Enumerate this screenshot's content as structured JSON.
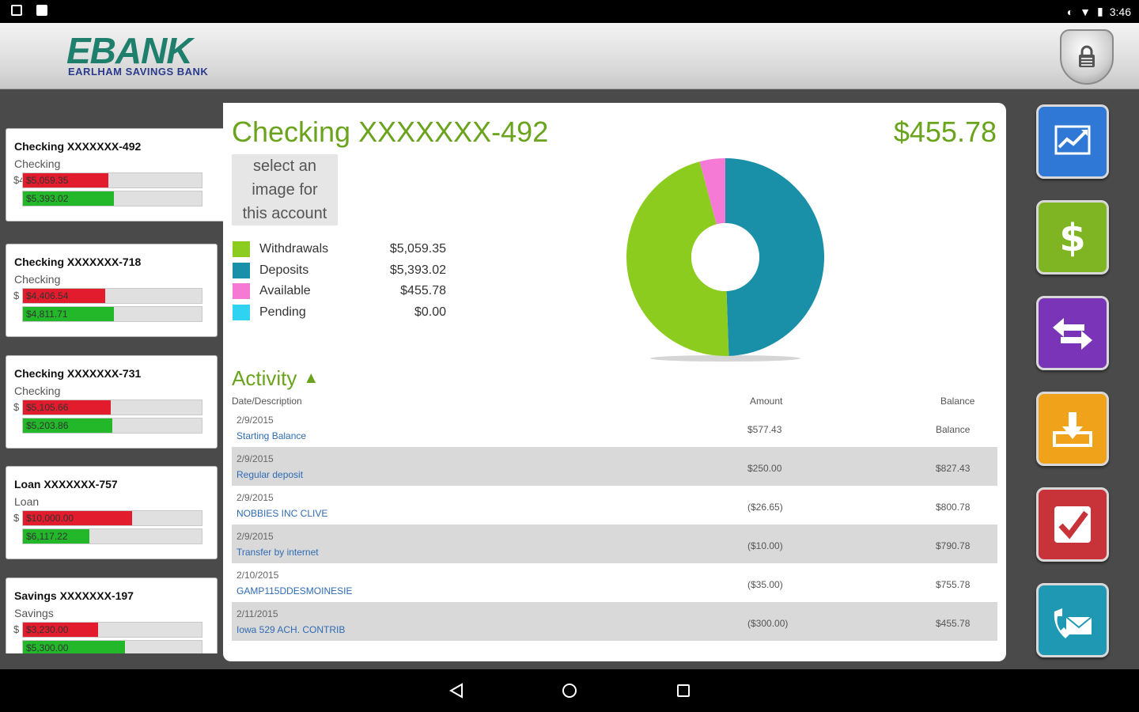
{
  "status_bar": {
    "time": "3:46"
  },
  "header": {
    "logo_main": "EBANK",
    "logo_sub": "EARLHAM SAVINGS BANK"
  },
  "accounts": [
    {
      "name": "Checking XXXXXXX-492",
      "type": "Checking",
      "prefix": "$4",
      "red_label": "$5,059.35",
      "green_label": "$5,393.02",
      "red_fill": 0.48,
      "green_fill": 0.51,
      "selected": true
    },
    {
      "name": "Checking XXXXXXX-718",
      "type": "Checking",
      "prefix": "$",
      "red_label": "$4,406.54",
      "green_label": "$4,811.71",
      "red_fill": 0.46,
      "green_fill": 0.51
    },
    {
      "name": "Checking XXXXXXX-731",
      "type": "Checking",
      "prefix": "$",
      "red_label": "$5,105.66",
      "green_label": "$5,203.86",
      "red_fill": 0.49,
      "green_fill": 0.5
    },
    {
      "name": "Loan XXXXXXX-757",
      "type": "Loan",
      "prefix": "$",
      "red_label": "$10,000.00",
      "green_label": "$6,117.22",
      "red_fill": 0.61,
      "green_fill": 0.37
    },
    {
      "name": "Savings XXXXXXX-197",
      "type": "Savings",
      "prefix": "$",
      "red_label": "$3,230.00",
      "green_label": "$5,300.00",
      "red_fill": 0.42,
      "green_fill": 0.57
    }
  ],
  "main": {
    "title": "Checking XXXXXXX-492",
    "balance": "$455.78",
    "image_prompt_1": "select an",
    "image_prompt_2": "image for",
    "image_prompt_3": "this account",
    "legend": [
      {
        "label": "Withdrawals",
        "value": "$5,059.35",
        "color": "#8ccc1f"
      },
      {
        "label": "Deposits",
        "value": "$5,393.02",
        "color": "#1a8fa8"
      },
      {
        "label": "Available",
        "value": "$455.78",
        "color": "#f57ad6"
      },
      {
        "label": "Pending",
        "value": "$0.00",
        "color": "#2fd2f0"
      }
    ],
    "activity_title": "Activity",
    "table_headers": {
      "date": "Date/Description",
      "amount": "Amount",
      "balance": "Balance"
    },
    "transactions": [
      {
        "date": "2/9/2015",
        "desc": "Starting Balance",
        "amount": "$577.43",
        "balance": "Balance"
      },
      {
        "date": "2/9/2015",
        "desc": "Regular deposit",
        "amount": "$250.00",
        "balance": "$827.43"
      },
      {
        "date": "2/9/2015",
        "desc": "NOBBIES INC CLIVE",
        "amount": "($26.65)",
        "balance": "$800.78"
      },
      {
        "date": "2/9/2015",
        "desc": "Transfer by internet",
        "amount": "($10.00)",
        "balance": "$790.78"
      },
      {
        "date": "2/10/2015",
        "desc": "GAMP115DDESMOINESIE",
        "amount": "($35.00)",
        "balance": "$755.78"
      },
      {
        "date": "2/11/2015",
        "desc": "Iowa 529 ACH. CONTRIB",
        "amount": "($300.00)",
        "balance": "$455.78"
      }
    ]
  },
  "actions": [
    {
      "name": "accounts-overview-button",
      "icon": "bank-chart-icon",
      "color": "#2f78d6"
    },
    {
      "name": "transfer-money-button",
      "icon": "dollar-icon",
      "color": "#7fb522"
    },
    {
      "name": "transfer-button",
      "icon": "arrows-exchange-icon",
      "color": "#7a34b8"
    },
    {
      "name": "deposit-button",
      "icon": "download-tray-icon",
      "color": "#f0a21a"
    },
    {
      "name": "bill-pay-button",
      "icon": "checkmark-icon",
      "color": "#c8333a"
    },
    {
      "name": "contact-button",
      "icon": "phone-mail-icon",
      "color": "#1f98b3"
    }
  ],
  "chart_data": {
    "type": "pie",
    "categories": [
      "Withdrawals",
      "Deposits",
      "Available",
      "Pending"
    ],
    "values": [
      5059.35,
      5393.02,
      455.78,
      0.0
    ],
    "colors": [
      "#8ccc1f",
      "#1a8fa8",
      "#f57ad6",
      "#2fd2f0"
    ],
    "title": ""
  }
}
